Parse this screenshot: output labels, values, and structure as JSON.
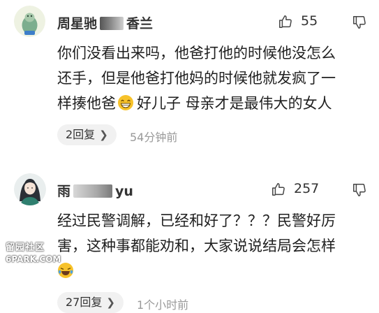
{
  "comments": [
    {
      "user_prefix": "周星驰",
      "user_suffix": "香兰",
      "likes": "55",
      "lines": [
        "你们没看出来吗，他爸打他的时候他没怎么",
        "还手，但是他爸打他妈的时候他就发疯了一",
        "样揍他爸"
      ],
      "emoji": "grinning-face-emoji",
      "line3_tail": "好儿子  母亲才是最伟大的女人",
      "reply_label": "2回复",
      "time": "54分钟前"
    },
    {
      "user_prefix": "雨",
      "user_suffix": "yu",
      "likes": "257",
      "lines": [
        "经过民警调解，已经和好了？？？民警好厉",
        "害，这种事都能劝和，大家说说结局会怎样"
      ],
      "emoji": "laughing-tears-emoji",
      "reply_label": "27回复",
      "time": "1个小时前"
    }
  ],
  "watermark": {
    "top": "留园社区",
    "bottom": "6PARK.COM"
  },
  "colors": {
    "text": "#1f1f1f",
    "meta": "#999999",
    "reply_bg": "#f1f1f1",
    "emoji": "#f7c22a"
  },
  "icons": {
    "like": "thumbs-up-outline-icon",
    "dislike": "thumbs-down-outline-icon",
    "reply_chevron": "chevron-right-icon"
  }
}
